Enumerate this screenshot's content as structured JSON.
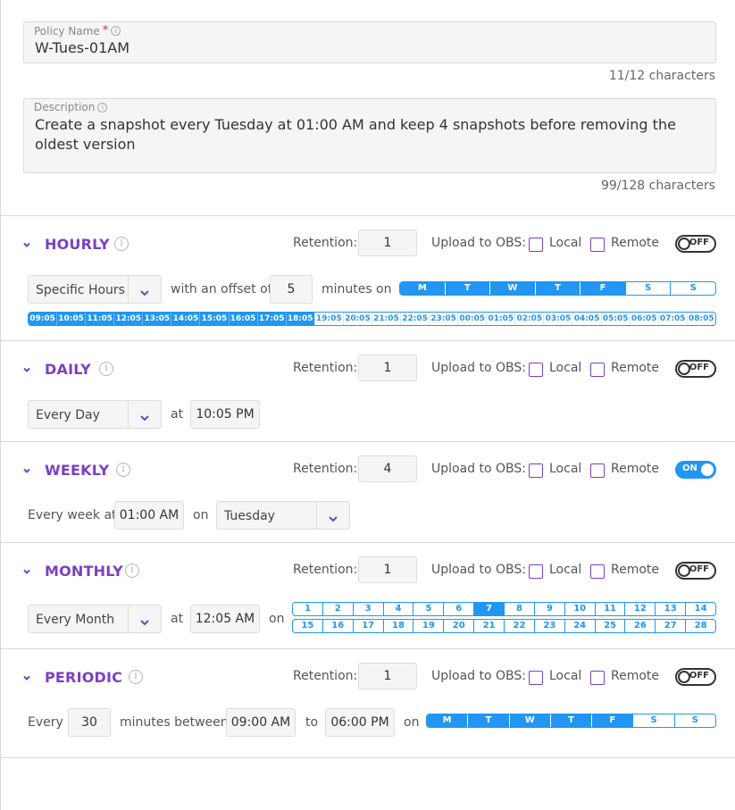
{
  "policy_name": {
    "label": "Policy Name",
    "required_mark": "*",
    "value": "W-Tues-01AM",
    "counter": "11/12 characters"
  },
  "description": {
    "label": "Description",
    "value": "Create a snapshot every Tuesday at 01:00 AM and keep 4 snapshots before removing the oldest version",
    "counter": "99/128 characters"
  },
  "common": {
    "retention_label": "Retention:",
    "upload_label": "Upload to OBS:",
    "local_label": "Local",
    "remote_label": "Remote",
    "info_glyph": "i",
    "on_text": "ON",
    "off_text": "OFF"
  },
  "colors": {
    "accent": "#7b3fc4",
    "selection": "#2196f3"
  },
  "hourly": {
    "title": "HOURLY",
    "retention": "1",
    "enabled": false,
    "mode": "Specific Hours",
    "offset_label": "with an offset of",
    "offset": "5",
    "minutes_label": "minutes",
    "on_label": "on",
    "days": [
      "M",
      "T",
      "W",
      "T",
      "F",
      "S",
      "S"
    ],
    "days_selected": [
      0,
      1,
      2,
      3,
      4
    ],
    "hours": [
      "09:05",
      "10:05",
      "11:05",
      "12:05",
      "13:05",
      "14:05",
      "15:05",
      "16:05",
      "17:05",
      "18:05",
      "19:05",
      "20:05",
      "21:05",
      "22:05",
      "23:05",
      "00:05",
      "01:05",
      "02:05",
      "03:05",
      "04:05",
      "05:05",
      "06:05",
      "07:05",
      "08:05"
    ],
    "hours_selected_count": 10
  },
  "daily": {
    "title": "DAILY",
    "retention": "1",
    "enabled": false,
    "mode": "Every Day",
    "at_label": "at",
    "time": "10:05 PM"
  },
  "weekly": {
    "title": "WEEKLY",
    "retention": "4",
    "enabled": true,
    "every_label": "Every week at",
    "time": "01:00 AM",
    "on_label": "on",
    "day": "Tuesday"
  },
  "monthly": {
    "title": "MONTHLY",
    "retention": "1",
    "enabled": false,
    "mode": "Every Month",
    "at_label": "at",
    "time": "12:05 AM",
    "on_label": "on",
    "row1": [
      "1",
      "2",
      "3",
      "4",
      "5",
      "6",
      "7",
      "8",
      "9",
      "10",
      "11",
      "12",
      "13",
      "14"
    ],
    "row2": [
      "15",
      "16",
      "17",
      "18",
      "19",
      "20",
      "21",
      "22",
      "23",
      "24",
      "25",
      "26",
      "27",
      "28"
    ],
    "selected_day": "7"
  },
  "periodic": {
    "title": "PERIODIC",
    "retention": "1",
    "enabled": false,
    "every_label": "Every",
    "interval": "30",
    "between_label": "minutes between",
    "start": "09:00 AM",
    "to_label": "to",
    "end": "06:00 PM",
    "on_label": "on",
    "days": [
      "M",
      "T",
      "W",
      "T",
      "F",
      "S",
      "S"
    ],
    "days_selected": [
      0,
      1,
      2,
      3,
      4
    ]
  }
}
